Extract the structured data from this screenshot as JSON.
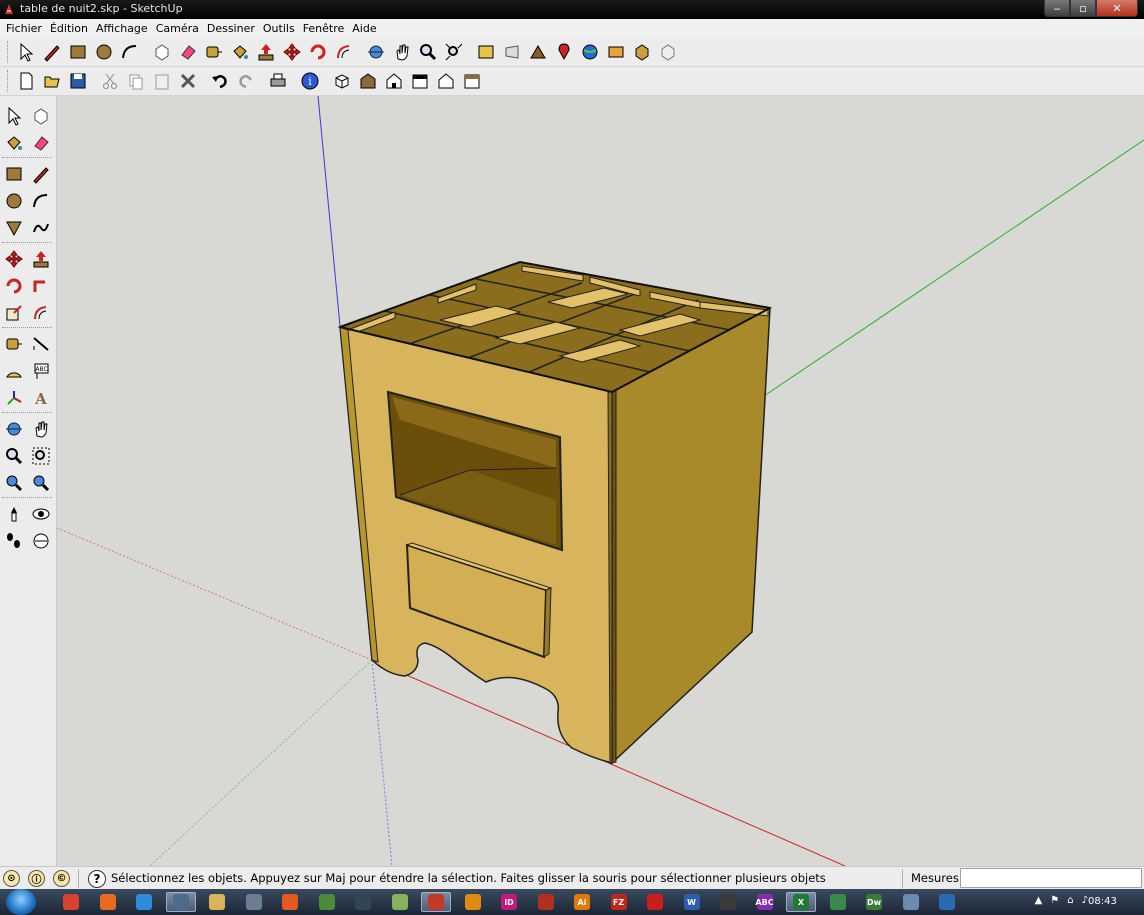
{
  "window": {
    "title": "table de nuit2.skp - SketchUp",
    "min_label": "‒",
    "max_label": "▫",
    "close_label": "✕"
  },
  "menu": [
    "Fichier",
    "Édition",
    "Affichage",
    "Caméra",
    "Dessiner",
    "Outils",
    "Fenêtre",
    "Aide"
  ],
  "toolbar_row1": [
    "select-icon",
    "pencil-icon",
    "rectangle-icon",
    "circle-icon",
    "arc-icon",
    "make-component-icon",
    "eraser-icon",
    "tape-measure-icon",
    "paint-bucket-icon",
    "push-pull-icon",
    "move-icon",
    "rotate-icon",
    "offset-icon",
    "orbit-icon",
    "pan-icon",
    "zoom-icon",
    "zoom-extents-icon",
    "get-models-icon",
    "share-model-icon",
    "warehouse-icon",
    "location-icon",
    "google-earth-icon",
    "photo-textures-icon",
    "get-components-icon",
    "share-component-icon"
  ],
  "toolbar_row2": [
    "new-icon",
    "open-icon",
    "save-icon",
    "cut-icon",
    "copy-icon",
    "paste-icon",
    "delete-icon",
    "undo-icon",
    "redo-icon",
    "print-icon",
    "model-info-icon",
    "iso-view-icon",
    "top-view-icon",
    "front-view-icon",
    "right-view-icon",
    "back-view-icon",
    "left-view-icon"
  ],
  "left_toolbar": [
    "select-icon",
    "make-component-icon",
    "paint-bucket-icon",
    "eraser-icon",
    "rectangle-icon",
    "line-icon",
    "circle-icon",
    "arc-icon",
    "polygon-icon",
    "freehand-icon",
    "move-icon",
    "push-pull-icon",
    "rotate-icon",
    "follow-me-icon",
    "scale-icon",
    "offset-icon",
    "tape-measure-icon",
    "dimension-icon",
    "protractor-icon",
    "text-icon",
    "axes-icon",
    "3d-text-icon",
    "orbit-icon",
    "pan-icon",
    "zoom-icon",
    "zoom-window-icon",
    "previous-view-icon",
    "next-view-icon",
    "position-camera-icon",
    "look-around-icon",
    "walk-icon",
    "section-plane-icon"
  ],
  "status": {
    "message": "Sélectionnez les objets. Appuyez sur Maj pour étendre la sélection. Faites glisser la souris pour sélectionner plusieurs objets",
    "measure_label": "Mesures",
    "measure_value": "",
    "geo_icons": [
      "geo-location-icon",
      "credits-icon",
      "user-icon"
    ],
    "help_symbol": "?"
  },
  "taskbar": {
    "items": [
      {
        "name": "chrome-icon",
        "color": "#d8412f",
        "active": false
      },
      {
        "name": "firefox-icon",
        "color": "#e66a1f",
        "active": false
      },
      {
        "name": "ie-icon",
        "color": "#2f8ad8",
        "active": false
      },
      {
        "name": "camera-app-icon",
        "color": "#4f6b8a",
        "active": true
      },
      {
        "name": "explorer-icon",
        "color": "#d9b45a",
        "active": false
      },
      {
        "name": "calculator-icon",
        "color": "#6b7d91",
        "active": false
      },
      {
        "name": "rss-icon",
        "color": "#e25a1e",
        "active": false
      },
      {
        "name": "tool-app-icon",
        "color": "#4a8a3a",
        "active": false
      },
      {
        "name": "network-icon",
        "color": "#345",
        "active": false
      },
      {
        "name": "notepad-icon",
        "color": "#8ab05a",
        "active": false
      },
      {
        "name": "sketchup-icon",
        "color": "#c23a2a",
        "active": true
      },
      {
        "name": "vlc-icon",
        "color": "#e08a10",
        "active": false
      },
      {
        "name": "indesign-icon",
        "color": "#c2187e",
        "active": false
      },
      {
        "name": "game-icon",
        "color": "#b03020",
        "active": false
      },
      {
        "name": "illustrator-icon",
        "color": "#e07a00",
        "active": false
      },
      {
        "name": "filezilla-icon",
        "color": "#c0281c",
        "active": false
      },
      {
        "name": "acrobat-icon",
        "color": "#c81e1e",
        "active": false
      },
      {
        "name": "word-icon",
        "color": "#2a5fb0",
        "active": false
      },
      {
        "name": "spreadsheet-app-icon",
        "color": "#3a3a3a",
        "active": false
      },
      {
        "name": "abc-icon",
        "color": "#8a2ab0",
        "active": false
      },
      {
        "name": "excel-icon",
        "color": "#1e7a3a",
        "active": true
      },
      {
        "name": "file-app-icon",
        "color": "#3a8a4a",
        "active": false
      },
      {
        "name": "dreamweaver-icon",
        "color": "#3a7a3a",
        "active": false
      },
      {
        "name": "notes-icon",
        "color": "#6a8ab0",
        "active": false
      },
      {
        "name": "outlook-icon",
        "color": "#2a6ab0",
        "active": false
      }
    ],
    "item_labels": {
      "indesign-icon": "ID",
      "illustrator-icon": "Ai",
      "filezilla-icon": "FZ",
      "word-icon": "W",
      "abc-icon": "ABC",
      "excel-icon": "X",
      "dreamweaver-icon": "Dw"
    },
    "clock": "08:43"
  }
}
